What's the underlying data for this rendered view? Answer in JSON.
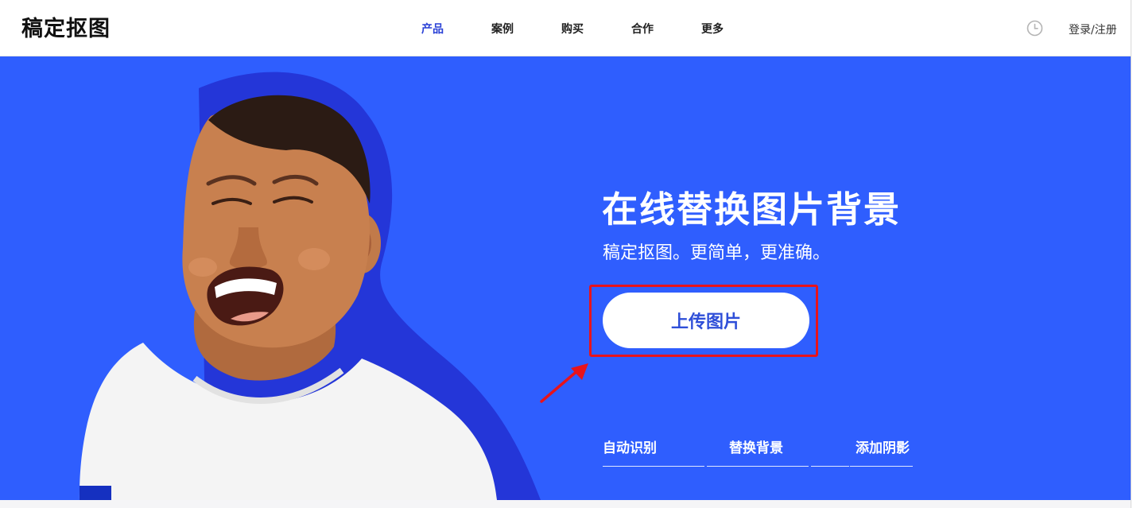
{
  "header": {
    "logo": "稿定抠图",
    "nav": [
      {
        "label": "产品",
        "active": true
      },
      {
        "label": "案例",
        "active": false
      },
      {
        "label": "购买",
        "active": false
      },
      {
        "label": "合作",
        "active": false
      },
      {
        "label": "更多",
        "active": false
      }
    ],
    "history_icon": "clock-icon",
    "login_label": "登录/注册"
  },
  "hero": {
    "title": "在线替换图片背景",
    "subtitle": "稿定抠图。更简单，更准确。",
    "upload_label": "上传图片",
    "features": [
      {
        "label": "自动识别"
      },
      {
        "label": "替换背景"
      },
      {
        "label": "添加阴影"
      }
    ],
    "photo": "laughing-boy-photo"
  },
  "annotation": {
    "highlight_color": "#e8131b",
    "arrow_icon": "red-arrow-icon"
  },
  "colors": {
    "hero_bg": "#2f5efe",
    "nav_active": "#2a41d6",
    "button_text": "#2f4fd8"
  }
}
